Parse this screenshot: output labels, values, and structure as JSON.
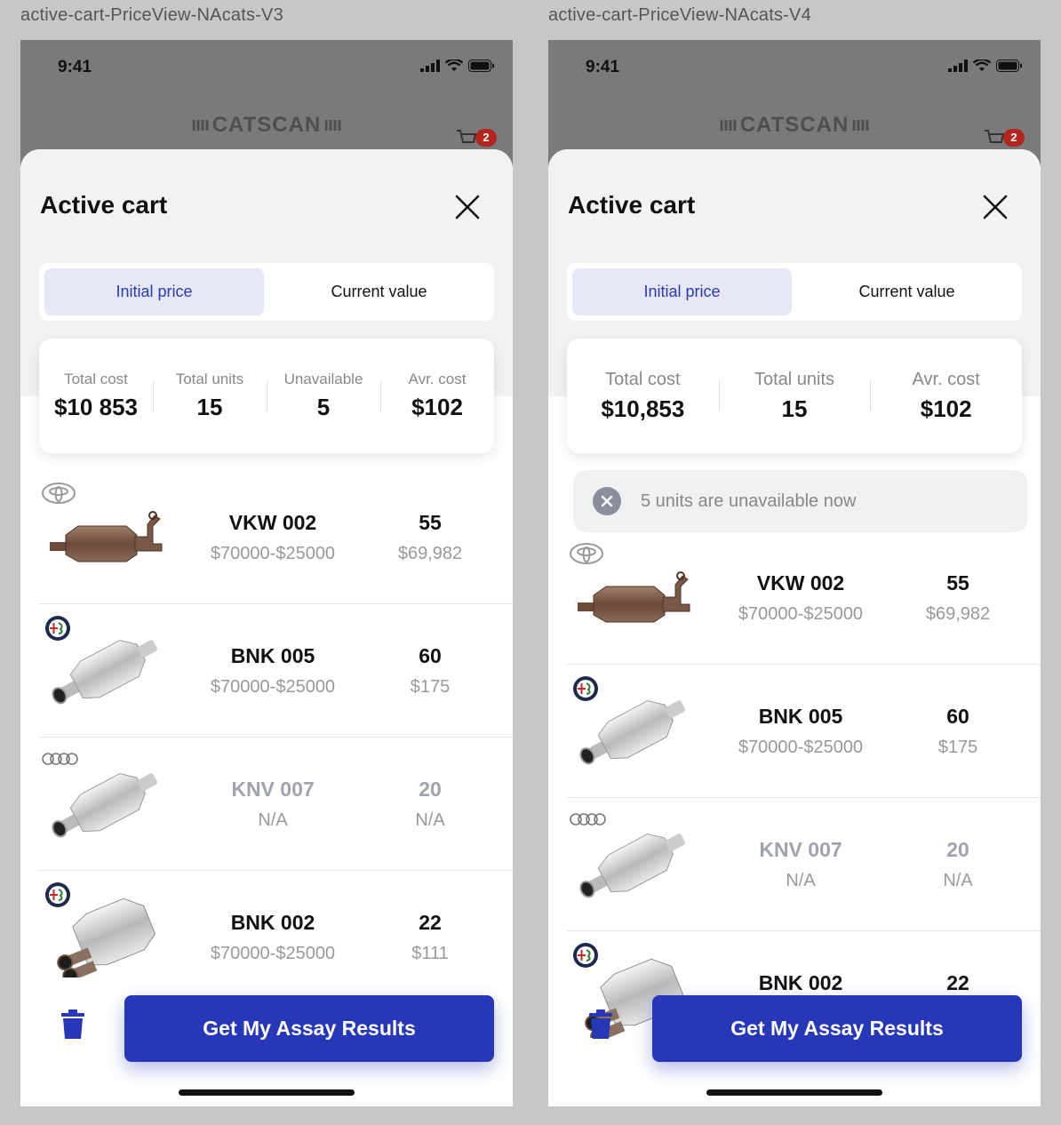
{
  "frames": [
    {
      "label": "active-cart-PriceView-NAcats-V3",
      "status_time": "9:41",
      "logo": "CATSCAN",
      "cart_badge": "2",
      "sheet_title": "Active cart",
      "toggle": {
        "initial": "Initial price",
        "current": "Current value",
        "active": "initial"
      },
      "stats": [
        {
          "label": "Total cost",
          "value": "$10 853"
        },
        {
          "label": "Total units",
          "value": "15"
        },
        {
          "label": "Unavailable",
          "value": "5"
        },
        {
          "label": "Avr. cost",
          "value": "$102"
        }
      ],
      "items": [
        {
          "brand": "toyota",
          "product_icon": "dirty-catalytic-converter",
          "code": "VKW 002",
          "range": "$70000-$25000",
          "qty": "55",
          "price": "$69,982",
          "available": true
        },
        {
          "brand": "alfa-romeo",
          "product_icon": "catalytic-converter",
          "code": "BNK 005",
          "range": "$70000-$25000",
          "qty": "60",
          "price": "$175",
          "available": true
        },
        {
          "brand": "audi",
          "product_icon": "catalytic-converter",
          "code": "KNV 007",
          "range": "N/A",
          "qty": "20",
          "price": "N/A",
          "available": false
        },
        {
          "brand": "alfa-romeo",
          "product_icon": "dual-catalytic-converter",
          "code": "BNK 002",
          "range": "$70000-$25000",
          "qty": "22",
          "price": "$111",
          "available": true
        }
      ],
      "cta": "Get My Assay Results"
    },
    {
      "label": "active-cart-PriceView-NAcats-V4",
      "status_time": "9:41",
      "logo": "CATSCAN",
      "cart_badge": "2",
      "sheet_title": "Active cart",
      "toggle": {
        "initial": "Initial price",
        "current": "Current value",
        "active": "initial"
      },
      "stats": [
        {
          "label": "Total cost",
          "value": "$10,853"
        },
        {
          "label": "Total units",
          "value": "15"
        },
        {
          "label": "Avr. cost",
          "value": "$102"
        }
      ],
      "notice": "5 units are unavailable now",
      "items": [
        {
          "brand": "toyota",
          "product_icon": "dirty-catalytic-converter",
          "code": "VKW 002",
          "range": "$70000-$25000",
          "qty": "55",
          "price": "$69,982",
          "available": true
        },
        {
          "brand": "alfa-romeo",
          "product_icon": "catalytic-converter",
          "code": "BNK 005",
          "range": "$70000-$25000",
          "qty": "60",
          "price": "$175",
          "available": true
        },
        {
          "brand": "audi",
          "product_icon": "catalytic-converter",
          "code": "KNV 007",
          "range": "N/A",
          "qty": "20",
          "price": "N/A",
          "available": false
        },
        {
          "brand": "alfa-romeo",
          "product_icon": "dual-catalytic-converter",
          "code": "BNK 002",
          "range": "",
          "qty": "22",
          "price": "",
          "available": true
        }
      ],
      "cta": "Get My Assay Results"
    }
  ],
  "colors": {
    "primary": "#2638b7",
    "toggle_active_bg": "#e6e8f7",
    "badge": "#b3261e",
    "muted": "#999999"
  }
}
